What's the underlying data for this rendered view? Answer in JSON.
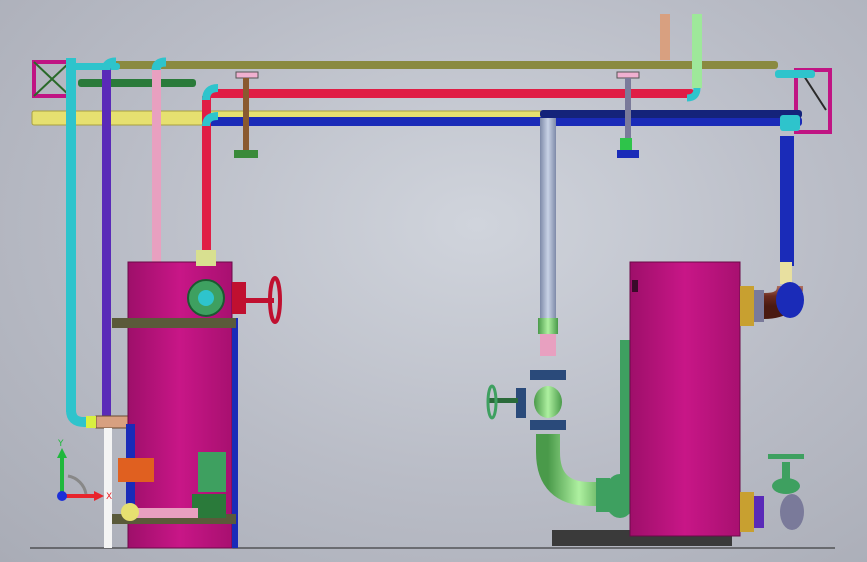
{
  "view": {
    "triad": {
      "x_label": "X",
      "y_label": "Y",
      "x_color": "#e8242c",
      "y_color": "#1fb83c",
      "z_color": "#1c2fd8"
    }
  },
  "colors": {
    "background": "#b9bcc6",
    "tank": "#c01483",
    "pipe_cyan": "#2ec4cc",
    "pipe_olive": "#8a8a40",
    "pipe_red": "#e01d45",
    "pipe_yellow": "#e6e070",
    "pipe_blue": "#1a2bb8",
    "pipe_navy": "#14237a",
    "pipe_purple": "#5a2ab8",
    "pipe_pink": "#e8a0c0",
    "pipe_green": "#2a7a3a",
    "pipe_steel": "#9aa8c8",
    "pipe_salmon": "#d8a080",
    "pipe_lightgreen": "#9ee89a",
    "valve_green": "#3ea060",
    "elbow_brown": "#7a3a28"
  },
  "icons": [
    "axis-triad-icon",
    "handwheel-valve-icon",
    "flange-icon",
    "pump-icon"
  ]
}
